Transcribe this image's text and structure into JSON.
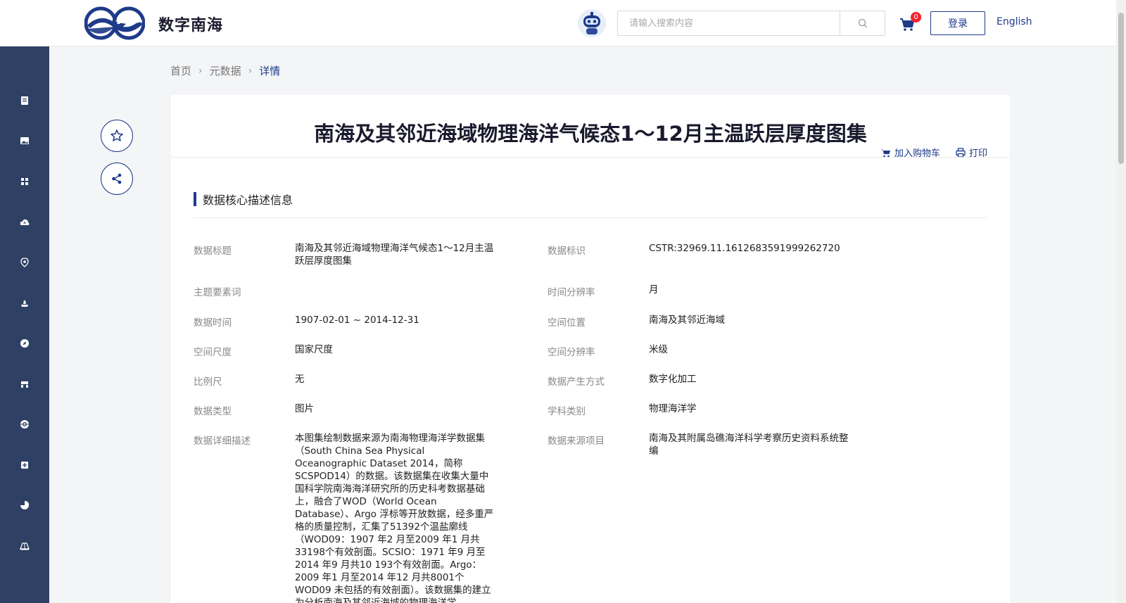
{
  "header": {
    "site_title": "数字南海",
    "search_placeholder": "请输入搜索内容",
    "cart_count": "0",
    "login_label": "登录",
    "language_label": "English"
  },
  "sidebar": {
    "icons": [
      "document-icon",
      "image-icon",
      "grid-icon",
      "cloud-upload-icon",
      "location-icon",
      "ship-icon",
      "compass-icon",
      "store-icon",
      "globe-icon",
      "plus-square-icon",
      "pie-chart-icon",
      "map-icon"
    ]
  },
  "breadcrumb": {
    "home": "首页",
    "metadata": "元数据",
    "detail": "详情"
  },
  "page": {
    "title": "南海及其邻近海域物理海洋气候态1～12月主温跃层厚度图集",
    "add_to_cart": "加入购物车",
    "print": "打印",
    "section_title": "数据核心描述信息"
  },
  "fields": {
    "data_title_label": "数据标题",
    "data_title_value": "南海及其邻近海域物理海洋气候态1～12月主温跃层厚度图集",
    "data_id_label": "数据标识",
    "data_id_value": "CSTR:32969.11.1612683591999262720",
    "keywords_label": "主题要素词",
    "keywords_value": "",
    "time_res_label": "时间分辨率",
    "time_res_value": "月",
    "data_time_label": "数据时间",
    "data_time_value": "1907-02-01 ~ 2014-12-31",
    "spatial_loc_label": "空间位置",
    "spatial_loc_value": "南海及其邻近海域",
    "spatial_scale_label": "空间尺度",
    "spatial_scale_value": "国家尺度",
    "spatial_res_label": "空间分辨率",
    "spatial_res_value": "米级",
    "scale_label": "比例尺",
    "scale_value": "无",
    "generation_label": "数据产生方式",
    "generation_value": "数字化加工",
    "data_type_label": "数据类型",
    "data_type_value": "图片",
    "discipline_label": "学科类别",
    "discipline_value": "物理海洋学",
    "description_label": "数据详细描述",
    "description_value": "本图集绘制数据来源为南海物理海洋学数据集（South China Sea Physical Oceanographic Dataset 2014，简称SCSPOD14）的数据。该数据集在收集大量中国科学院南海海洋研究所的历史科考数据基础上，融合了WOD（World Ocean Database）、Argo 浮标等开放数据，经多重严格的质量控制，汇集了51392个温盐廓线（WOD09：1907 年2 月至2009 年1 月共33198个有效剖面。SCSIO：1971 年9 月至2014 年9 月共10 193个有效剖面。Argo：2009 年1 月至2014 年12 月共8001个WOD09 未包括的有效剖面）。该数据集的建立为分析南海及其邻近海域的物理海洋学",
    "source_project_label": "数据来源项目",
    "source_project_value": "南海及其附属岛礁海洋科学考察历史资料系统整编"
  },
  "colors": {
    "primary": "#1e3a8a",
    "sidebar_bg": "#2f4065",
    "badge": "#f5222d"
  }
}
